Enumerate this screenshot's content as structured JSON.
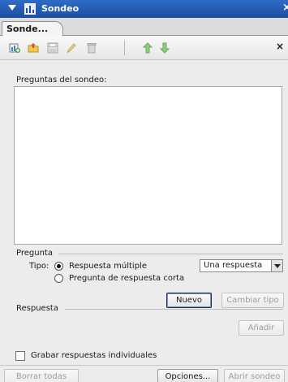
{
  "titlebar": {
    "title": "Sondeo",
    "close_glyph": "×"
  },
  "tabs": [
    {
      "label": "Sonde..."
    }
  ],
  "toolbar": {
    "icons": [
      "add-question-icon",
      "import-icon",
      "save-icon",
      "edit-icon",
      "delete-icon",
      "move-up-icon",
      "move-down-icon"
    ],
    "close_glyph": "×"
  },
  "questions": {
    "label": "Preguntas del sondeo:",
    "items": []
  },
  "pregunta": {
    "section_label": "Pregunta",
    "tipo_label": "Tipo:",
    "options": [
      {
        "label": "Respuesta múltiple",
        "selected": true
      },
      {
        "label": "Pregunta de respuesta corta",
        "selected": false
      }
    ],
    "answer_mode": "Una respuesta",
    "nuevo_button": "Nuevo",
    "cambiar_tipo_button": "Cambiar tipo"
  },
  "respuesta": {
    "section_label": "Respuesta",
    "anadir_button": "Añadir"
  },
  "grabar": {
    "label": "Grabar respuestas individuales",
    "checked": false
  },
  "footer": {
    "borrar_todas_button": "Borrar todas",
    "opciones_button": "Opciones...",
    "abrir_sondeo_button": "Abrir sondeo"
  },
  "colors": {
    "titlebar": "#1c4f9e",
    "panel": "#ececec",
    "list_bg": "#ffffff"
  }
}
